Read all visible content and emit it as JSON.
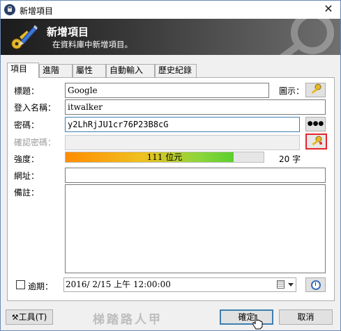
{
  "window": {
    "title": "新增項目",
    "close_symbol": "✕"
  },
  "banner": {
    "title": "新增項目",
    "subtitle": "在資料庫中新增項目。"
  },
  "tabs": [
    {
      "label": "項目",
      "active": true
    },
    {
      "label": "進階",
      "active": false
    },
    {
      "label": "屬性",
      "active": false
    },
    {
      "label": "自動輸入",
      "active": false
    },
    {
      "label": "歷史紀錄",
      "active": false
    }
  ],
  "form": {
    "title_label": "標題：",
    "title_value": "Google",
    "icon_label": "圖示：",
    "username_label": "登入名稱：",
    "username_value": "itwalker",
    "password_label": "密碼：",
    "password_value": "y2LhRjJU1cr76P23B8cG",
    "show_password_symbol": "●●●",
    "confirm_label": "確認密碼：",
    "confirm_value": "",
    "strength_label": "強度：",
    "strength_text": "111 位元",
    "strength_fraction": 0.85,
    "char_count": "20 字",
    "url_label": "網址：",
    "url_value": "",
    "notes_label": "備註：",
    "notes_value": "",
    "expiry_label": "逾期：",
    "expiry_checked": false,
    "expiry_value": "2016/ 2/15 上午 12:00:00"
  },
  "footer": {
    "tools_label": "工具(T)",
    "ok_label": "確定",
    "cancel_label": "取消",
    "watermark": "梯踏路人甲"
  },
  "colors": {
    "accent_focus": "#3c7fb1",
    "highlight_border": "#e3252b"
  }
}
